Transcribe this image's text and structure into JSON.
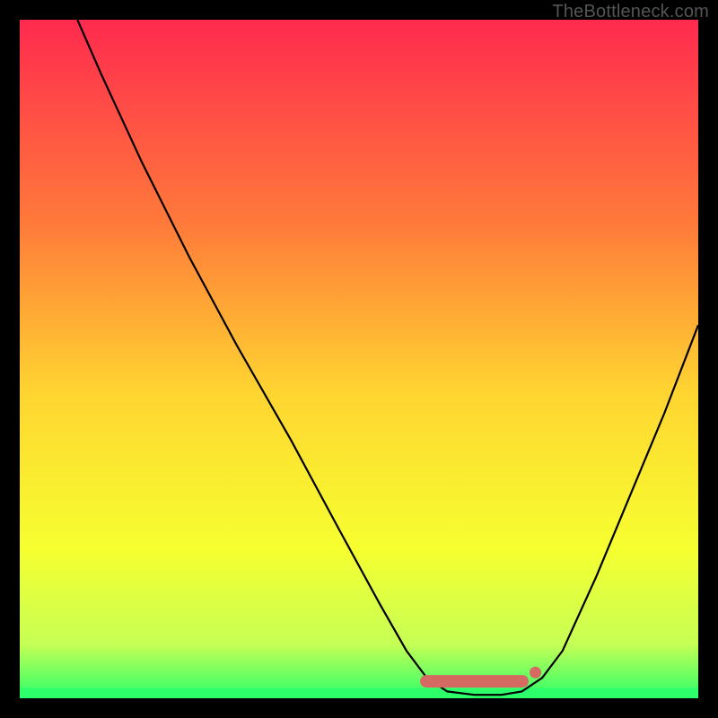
{
  "watermark": "TheBottleneck.com",
  "chart_data": {
    "type": "line",
    "title": "",
    "xlabel": "",
    "ylabel": "",
    "xlim": [
      0,
      100
    ],
    "ylim": [
      0,
      100
    ],
    "curve": [
      {
        "x": 8.5,
        "y": 100
      },
      {
        "x": 12,
        "y": 92
      },
      {
        "x": 18,
        "y": 79
      },
      {
        "x": 25,
        "y": 65
      },
      {
        "x": 32,
        "y": 52
      },
      {
        "x": 40,
        "y": 38
      },
      {
        "x": 47,
        "y": 25
      },
      {
        "x": 53,
        "y": 14
      },
      {
        "x": 57,
        "y": 7
      },
      {
        "x": 60,
        "y": 3
      },
      {
        "x": 63,
        "y": 1
      },
      {
        "x": 67,
        "y": 0.5
      },
      {
        "x": 71,
        "y": 0.5
      },
      {
        "x": 74,
        "y": 1
      },
      {
        "x": 77,
        "y": 3
      },
      {
        "x": 80,
        "y": 7
      },
      {
        "x": 85,
        "y": 18
      },
      {
        "x": 90,
        "y": 30
      },
      {
        "x": 95,
        "y": 42
      },
      {
        "x": 100,
        "y": 55
      }
    ],
    "bottom_band": {
      "green_y": 1.5,
      "yellow_fade_top": 8
    },
    "marker_bar": {
      "x_start": 59,
      "x_end": 75,
      "y": 2.5,
      "color": "#d56a63"
    },
    "marker_dot": {
      "x": 76,
      "y": 3.8,
      "color": "#d56a63"
    },
    "gradient_stops": [
      {
        "offset": 0,
        "color": "#ff2a4f"
      },
      {
        "offset": 30,
        "color": "#ff7a3a"
      },
      {
        "offset": 55,
        "color": "#ffd531"
      },
      {
        "offset": 78,
        "color": "#f6ff30"
      },
      {
        "offset": 92,
        "color": "#c6ff55"
      },
      {
        "offset": 100,
        "color": "#2dff6a"
      }
    ]
  }
}
